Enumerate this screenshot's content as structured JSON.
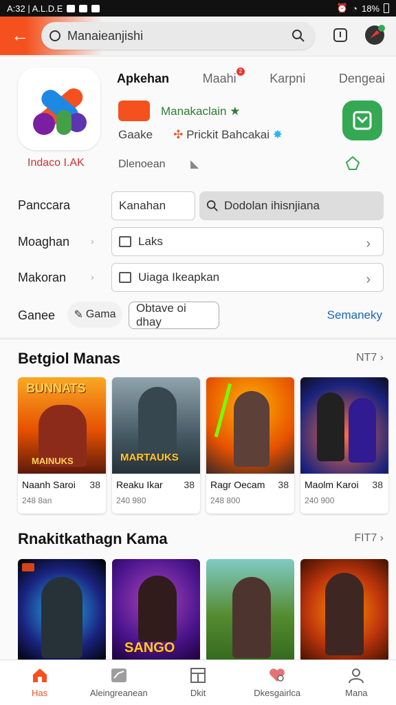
{
  "status": {
    "time": "A:32 | A.L.D.E",
    "battery": "18%"
  },
  "search": {
    "value": "Manaieanjishi"
  },
  "app": {
    "label": "Indaco I.AK"
  },
  "tabs": [
    {
      "label": "Apkehan"
    },
    {
      "label": "Maahi",
      "badge": "2"
    },
    {
      "label": "Karpni"
    },
    {
      "label": "Dengeai"
    }
  ],
  "info": {
    "badge_text": "Manakaclain",
    "line2_a": "Gaake",
    "line2_b": "Prickit Bahcakai",
    "line3": "Dlenoean"
  },
  "form": {
    "row1_label": "Panccara",
    "row1_field": "Kanahan",
    "row1_search": "Dodolan ihisnjiana",
    "row2_label": "Moaghan",
    "row2_field": "Laks",
    "row3_label": "Makoran",
    "row3_field": "Uiaga Ikeapkan",
    "row4_label": "Ganee",
    "row4_chip": "Gama",
    "row4_button": "Obtave oi dhay",
    "row4_link": "Semaneky"
  },
  "section1": {
    "title": "Betgiol Manas",
    "more": "NT7",
    "cards": [
      {
        "title": "Naanh Saroi",
        "num": "38",
        "sub": "248 8an",
        "art": "BUNNATS",
        "art2": "MAINUKS"
      },
      {
        "title": "Reaku Ikar",
        "num": "38",
        "sub": "240 980",
        "art": "",
        "art2": "MARTAUKS"
      },
      {
        "title": "Ragr Oecam",
        "num": "38",
        "sub": "248 800",
        "art": "",
        "art2": ""
      },
      {
        "title": "Maolm Karoi",
        "num": "38",
        "sub": "240 900",
        "art": "",
        "art2": ""
      }
    ]
  },
  "section2": {
    "title": "Rnakitkathagn Kama",
    "more": "FIT7",
    "cards": [
      {
        "art": ""
      },
      {
        "art": "SANGO"
      },
      {
        "art": ""
      },
      {
        "art": ""
      }
    ]
  },
  "bottom": [
    {
      "label": "Has",
      "icon": "home-icon"
    },
    {
      "label": "Aleingreanean",
      "icon": "chart-icon"
    },
    {
      "label": "Dkit",
      "icon": "grid-icon"
    },
    {
      "label": "Dkesgairlca",
      "icon": "heart-icon"
    },
    {
      "label": "Mana",
      "icon": "person-icon"
    }
  ],
  "colors": {
    "accent": "#f4511e",
    "green": "#34a853",
    "link": "#1565c0"
  }
}
